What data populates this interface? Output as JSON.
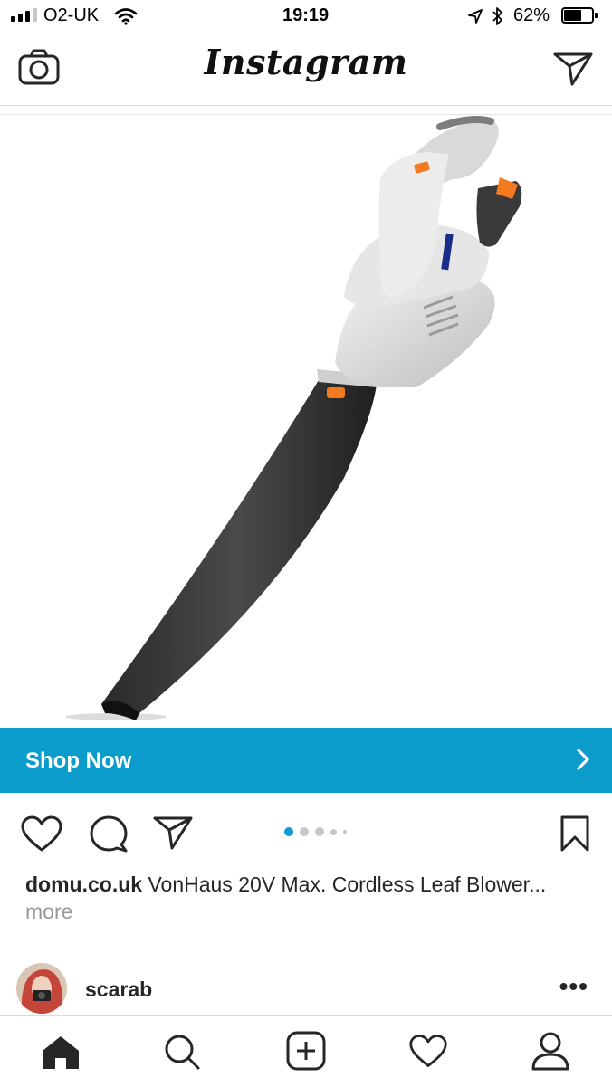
{
  "status_bar": {
    "carrier": "O2-UK",
    "time": "19:19",
    "battery": "62%",
    "battery_level": 0.62
  },
  "header": {
    "logo": "Instagram",
    "left_icon": "camera-icon",
    "right_icon": "direct-message-icon"
  },
  "post": {
    "image_icon": "leaf-blower-photo",
    "shop_label": "Shop Now",
    "carousel": {
      "count": 5,
      "active": 0
    },
    "caption_user": "domu.co.uk",
    "caption_text": " VonHaus 20V Max. Cordless Leaf Blower...",
    "caption_more": " more",
    "accent_color": "#0b9ccb"
  },
  "next_post": {
    "username": "scarab",
    "more": "•••"
  },
  "tab_bar": {
    "icons": [
      "home-icon",
      "search-icon",
      "new-post-icon",
      "activity-icon",
      "profile-icon"
    ]
  }
}
